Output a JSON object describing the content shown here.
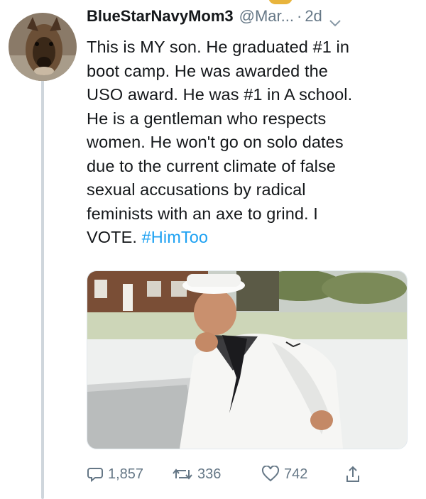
{
  "tweet": {
    "display_name": "BlueStarNavyMom3",
    "handle": "@Mar...",
    "separator": "·",
    "time": "2d",
    "text_lines": [
      "This is MY son. He graduated #1 in",
      "boot camp. He was awarded the",
      "USO award. He was #1 in A school.",
      "He is a gentleman who respects",
      "women. He won't go on solo dates",
      "due to the current climate of false",
      "sexual accusations by radical",
      "feminists with an axe to grind. I"
    ],
    "last_line_text": "VOTE. ",
    "hashtag": "#HimToo"
  },
  "actions": {
    "reply_count": "1,857",
    "retweet_count": "336",
    "like_count": "742"
  },
  "icons": {
    "reply": "reply-icon",
    "retweet": "retweet-icon",
    "like": "heart-icon",
    "share": "share-icon",
    "menu": "chevron-down-icon"
  },
  "colors": {
    "text": "#14171a",
    "muted": "#657786",
    "hashtag": "#1da1f2",
    "thread_line": "#cfd6dc"
  }
}
